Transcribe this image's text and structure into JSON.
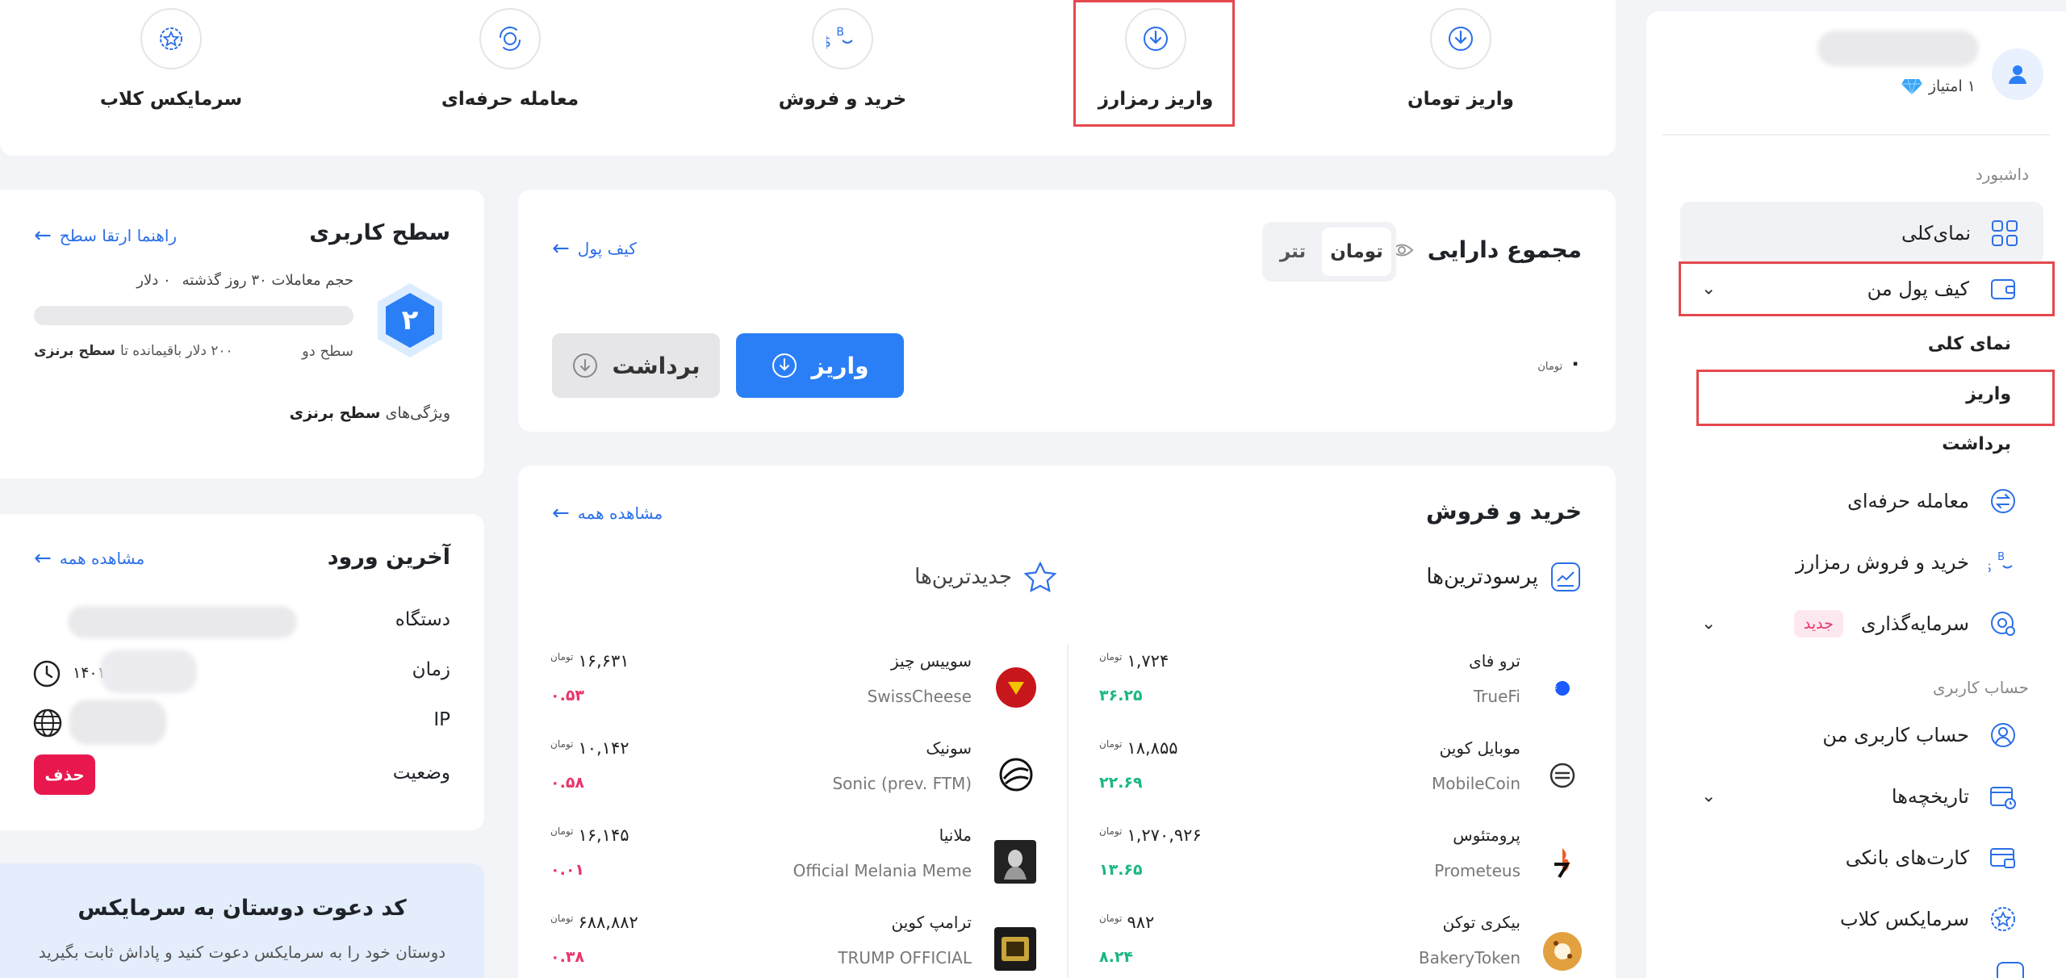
{
  "quick_actions": [
    {
      "label": "واریز تومان",
      "icon": "download-circle-icon"
    },
    {
      "label": "واریز رمزارز",
      "icon": "download-circle-icon"
    },
    {
      "label": "خرید و فروش",
      "icon": "dollar-bitcoin-exchange-icon"
    },
    {
      "label": "معامله حرفه‌ای",
      "icon": "refresh-coin-icon"
    },
    {
      "label": "سرمایکس کلاب",
      "icon": "star-badge-icon"
    }
  ],
  "profile": {
    "points": "۱ امتیاز"
  },
  "sidebar": {
    "section_dashboard": "داشبورد",
    "overview": "نمای‌کلی",
    "my_wallet": "کیف پول من",
    "wallet_sub": [
      "نمای کلی",
      "واریز",
      "برداشت"
    ],
    "pro_trade": "معامله حرفه‌ای",
    "buy_sell_crypto": "خرید و فروش رمزارز",
    "investment": "سرمایه‌گذاری",
    "investment_badge": "جدید",
    "section_account": "حساب کاربری",
    "my_account": "حساب کاربری من",
    "histories": "تاریخچه‌ها",
    "bank_cards": "کارت‌های بانکی",
    "club": "سرمایکس کلاب"
  },
  "assets": {
    "title": "مجموع دارایی",
    "toggle": [
      "تومان",
      "تتر"
    ],
    "wallet_link": "کیف پول",
    "balance": "۰",
    "unit": "تومان",
    "deposit": "واریز",
    "withdraw": "برداشت"
  },
  "buy_sell": {
    "title": "خرید و فروش",
    "see_all": "مشاهده همه",
    "tab_profitable": "پرسودترین‌ها",
    "tab_newest": "جدیدترین‌ها",
    "unit": "تومان",
    "profitable": [
      {
        "name": "ترو فای",
        "symbol": "TrueFi",
        "price": "۱,۷۲۴",
        "change": "۳۶.۲۵"
      },
      {
        "name": "موبایل کوین",
        "symbol": "MobileCoin",
        "price": "۱۸,۸۵۵",
        "change": "۲۲.۶۹"
      },
      {
        "name": "پرومتئوس",
        "symbol": "Prometeus",
        "price": "۱,۲۷۰,۹۲۶",
        "change": "۱۳.۶۵"
      },
      {
        "name": "بیکری توکن",
        "symbol": "BakeryToken",
        "price": "۹۸۲",
        "change": "۸.۲۴"
      }
    ],
    "newest": [
      {
        "name": "سوییس چیز",
        "symbol": "SwissCheese",
        "price": "۱۶,۶۳۱",
        "change": "۰.۵۳"
      },
      {
        "name": "سونیک",
        "symbol": "Sonic (prev. FTM)",
        "price": "۱۰,۱۴۲",
        "change": "۰.۵۸"
      },
      {
        "name": "ملانیا",
        "symbol": "Official Melania Meme",
        "price": "۱۶,۱۴۵",
        "change": "۰.۰۱"
      },
      {
        "name": "ترامپ کوین",
        "symbol": "TRUMP OFFICIAL",
        "price": "۶۸۸,۸۸۲",
        "change": "۰.۳۸"
      }
    ]
  },
  "level": {
    "title": "سطح کاربری",
    "guide_link": "راهنما ارتقا سطح",
    "level_number": "۲",
    "volume_label": "حجم معاملات ۳۰ روز گذشته",
    "volume_value": "۰ دلار",
    "level_name": "سطح دو",
    "remaining_amount": "۲۰۰ دلار باقیمانده تا",
    "remaining_target": "سطح برنزی",
    "features_prefix": "ویژگی‌های",
    "features_target": "سطح برنزی"
  },
  "last_login": {
    "title": "آخرین ورود",
    "see_all": "مشاهده همه",
    "device_label": "دستگاه",
    "time_label": "زمان",
    "time_value": "۱۴۰۱",
    "ip_label": "IP",
    "status_label": "وضعیت",
    "delete": "حذف"
  },
  "invite": {
    "title": "کد دعوت دوستان به سرمایکس",
    "desc": "دوستان خود را به سرمایکس دعوت کنید و پاداش ثابت بگیرید"
  },
  "colors": {
    "accent": "#2b7ff6",
    "highlight": "#e5484d",
    "up": "#1bb784",
    "down": "#e8366b"
  }
}
